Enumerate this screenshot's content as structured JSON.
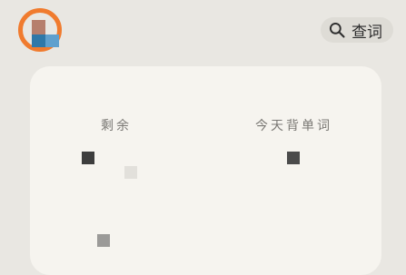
{
  "header": {
    "search": {
      "label": "查词",
      "icon": "search-icon"
    },
    "logo": {
      "icon": "app-logo-icon",
      "colors": {
        "ring": "#f07b2e",
        "top": "#b67f6d",
        "bottom_left": "#2f78a8",
        "bottom_right": "#5fa0ce"
      }
    }
  },
  "card": {
    "stats": [
      {
        "label": "剩余"
      },
      {
        "label": "今天背单词"
      }
    ]
  },
  "colors": {
    "background": "#e9e7e2",
    "card": "#f6f4ef",
    "search_pill": "#dedcd6",
    "text_primary": "#2d2d2d",
    "text_secondary": "#7a7874"
  }
}
